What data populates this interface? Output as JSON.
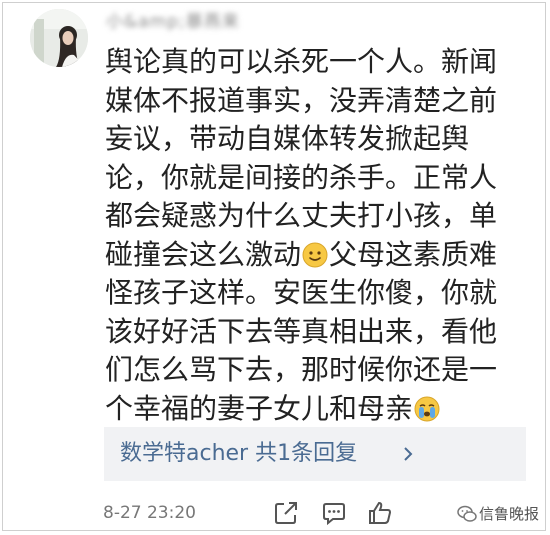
{
  "comment": {
    "username": "小&amp;暴燕来 ",
    "lines": [
      "舆论真的可以杀死一个人。新闻",
      "媒体不报道事实，没弄清楚之前",
      "妄议，带动自媒体转发掀起舆",
      "论，你就是间接的杀手。正常人",
      "都会疑惑为什么丈夫打小孩，单",
      "碰撞会这么激动",
      "父母这素质难",
      "怪孩子这样。安医生你傻，你就",
      "该好好活下去等真相出来，看他",
      "们怎么骂下去，那时候你还是一",
      "个幸福的妻子女儿和母亲"
    ],
    "emojis": [
      "smile-emoji",
      "crying-emoji"
    ]
  },
  "reply": {
    "label": "数学特acher  共1条回复"
  },
  "footer": {
    "timestamp": "8-27 23:20",
    "icons": [
      "share-icon",
      "comment-icon",
      "like-icon"
    ]
  },
  "watermark": {
    "text": "信鲁晚报"
  },
  "colors": {
    "reply_link": "#4a6b92",
    "reply_bg": "#f1f2f4",
    "emoji_yellow": "#f7c844"
  }
}
